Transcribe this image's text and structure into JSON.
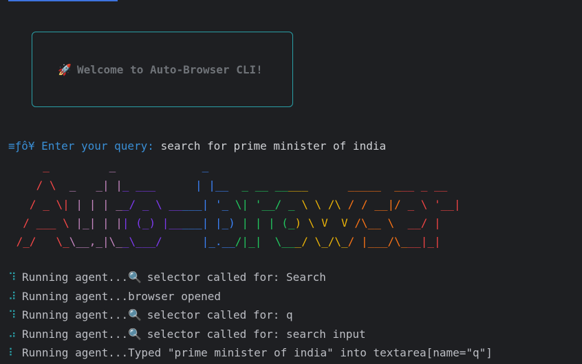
{
  "welcome": {
    "icon": "rocket-icon",
    "text": "Welcome to Auto-Browser CLI!"
  },
  "query": {
    "prefix": "≡ƒô¥",
    "prompt": "Enter your query:",
    "value": "search for prime minister of india"
  },
  "banner": {
    "lines": [
      "     _         _             _                                     ",
      "    / \\  _   _| |_ ___      | |__  _ __ _____      _____  ___ _ __ ",
      "   / _ \\| | | | __/ _ \\ _____| '_ \\| '__/ _ \\ \\ /\\ / / __|/ _ \\ '__|",
      "  / ___ \\ |_| | || (_) |_____| |_) | | | (_) \\ V  V /\\__ \\  __/ |   ",
      " /_/   \\_\\__,_|\\__\\___/      |_.__/|_|  \\___/ \\_/\\_/ |___/\\___|_|   "
    ],
    "colors": [
      "#f44747",
      "#c586c0",
      "#7c3aed",
      "#3b82f6",
      "#22c55e",
      "#eab308",
      "#f97316",
      "#ef4444"
    ]
  },
  "log": [
    {
      "spinner": "⠹",
      "text": "Running agent...",
      "icon": "search-icon",
      "message": " selector called for: Search"
    },
    {
      "spinner": "⠼",
      "text": "Running agent...",
      "icon": "",
      "message": "browser opened"
    },
    {
      "spinner": "⠹",
      "text": "Running agent...",
      "icon": "search-icon",
      "message": " selector called for: q"
    },
    {
      "spinner": "⠴",
      "text": "Running agent...",
      "icon": "search-icon",
      "message": " selector called for: search input"
    },
    {
      "spinner": "⠇",
      "text": "Running agent...",
      "icon": "",
      "message": "Typed \"prime minister of india\" into textarea[name=\"q\"]"
    }
  ]
}
